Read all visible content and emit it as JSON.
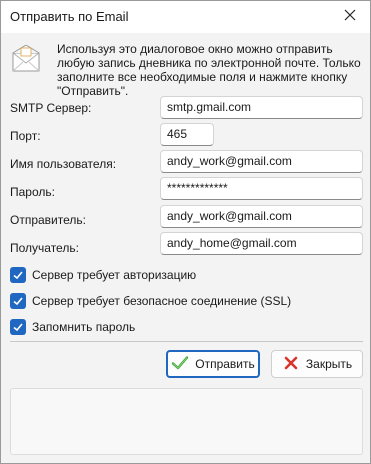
{
  "window": {
    "title": "Отправить по Email"
  },
  "info": {
    "text": "Используя это диалоговое окно можно отправить любую запись дневника по электронной почте. Только заполните все необходимые поля и нажмите кнопку \"Отправить\"."
  },
  "form": {
    "smtp_label": "SMTP Сервер:",
    "smtp_value": "smtp.gmail.com",
    "port_label": "Порт:",
    "port_value": "465",
    "username_label": "Имя пользователя:",
    "username_value": "andy_work@gmail.com",
    "password_label": "Пароль:",
    "password_value": "*************",
    "sender_label": "Отправитель:",
    "sender_value": "andy_work@gmail.com",
    "recipient_label": "Получатель:",
    "recipient_value": "andy_home@gmail.com"
  },
  "options": {
    "auth_label": "Сервер требует авторизацию",
    "auth_checked": true,
    "ssl_label": "Сервер требует безопасное соединение (SSL)",
    "ssl_checked": true,
    "remember_label": "Запомнить пароль",
    "remember_checked": true
  },
  "buttons": {
    "send_label": "Отправить",
    "close_label": "Закрыть"
  },
  "icons": {
    "close": "close-icon",
    "info": "envelope-icon",
    "send": "checkmark-icon",
    "cancel": "x-icon"
  },
  "colors": {
    "accent": "#1f67c0",
    "send_icon": "#3aa635",
    "cancel_icon": "#d9342b"
  }
}
